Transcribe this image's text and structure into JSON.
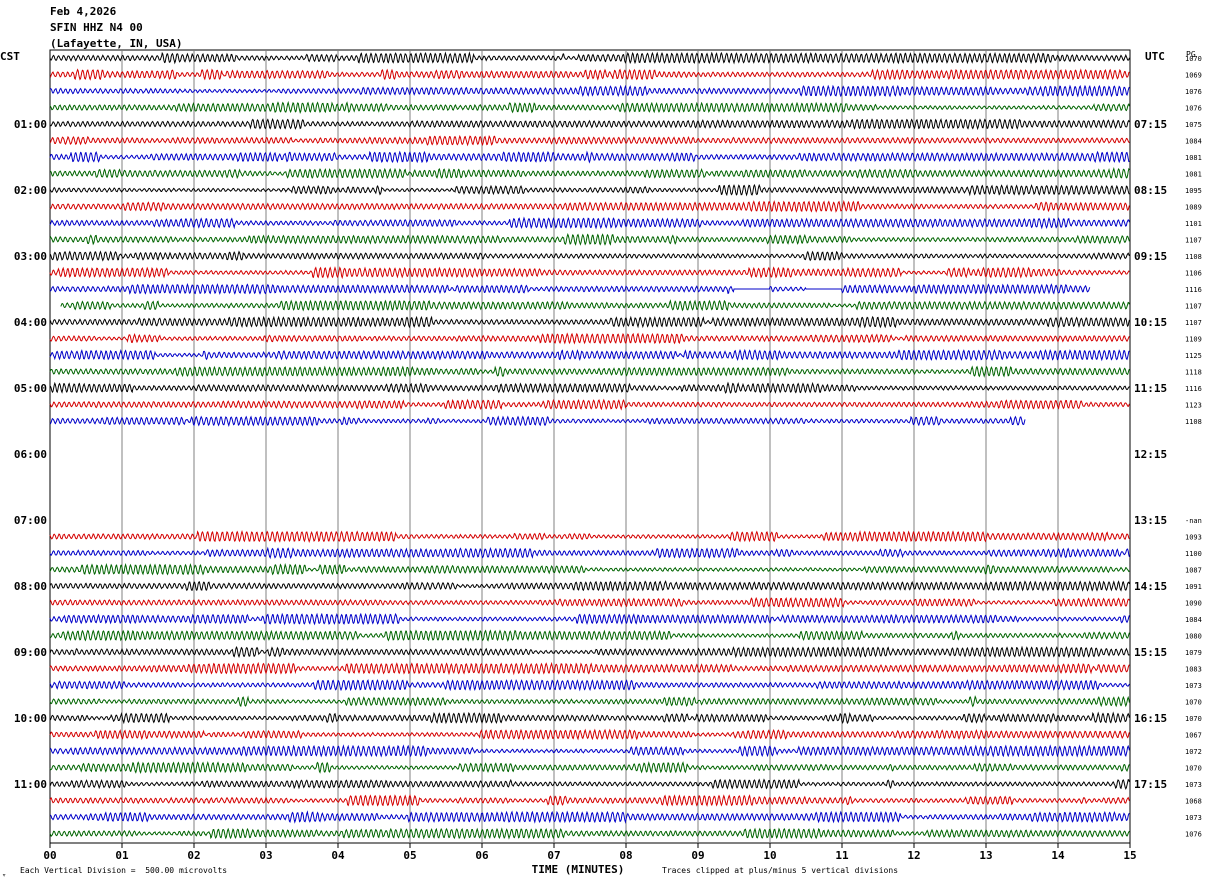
{
  "header": {
    "date": "Feb 4,2026",
    "station": "SFIN HHZ N4 00",
    "location": "(Lafayette, IN, USA)"
  },
  "left_tz": "CST",
  "right_tz": "UTC",
  "pg_label": "PG",
  "footer": {
    "scale": "Each Vertical Division =  500.00 microvolts",
    "clip": "Traces clipped at plus/minus 5 vertical divisions",
    "corner": "▿"
  },
  "colors": {
    "cycle": [
      "#000000",
      "#d40000",
      "#0000c8",
      "#006400"
    ],
    "grid": "#808080"
  },
  "chart_data": {
    "type": "line",
    "title": "Feb 4,2026 SFIN HHZ N4 00 (Lafayette, IN, USA)",
    "xlabel": "TIME (MINUTES)",
    "xlim": [
      0,
      15
    ],
    "x_ticks": [
      "00",
      "01",
      "02",
      "03",
      "04",
      "05",
      "06",
      "07",
      "08",
      "09",
      "10",
      "11",
      "12",
      "13",
      "14",
      "15"
    ],
    "grid": true,
    "lines_per_hour": 4,
    "minutes_per_line": 15,
    "y_left_hour_labels": [
      "01:00",
      "02:00",
      "03:00",
      "04:00",
      "05:00",
      "06:00",
      "07:00",
      "08:00",
      "09:00",
      "10:00",
      "11:00"
    ],
    "y_right_hour_labels": [
      "07:15",
      "08:15",
      "09:15",
      "10:15",
      "11:15",
      "12:15",
      "13:15",
      "14:15",
      "15:15",
      "16:15",
      "17:15"
    ],
    "traces": [
      {
        "line": 0,
        "color": "black",
        "amp": "1070",
        "start": 0,
        "end": 15
      },
      {
        "line": 1,
        "color": "red",
        "amp": "1069",
        "start": 0,
        "end": 15
      },
      {
        "line": 2,
        "color": "blue",
        "amp": "1076",
        "start": 0,
        "end": 15
      },
      {
        "line": 3,
        "color": "green",
        "amp": "1076",
        "start": 0,
        "end": 15
      },
      {
        "line": 4,
        "color": "black",
        "amp": "1075",
        "start": 0,
        "end": 15
      },
      {
        "line": 5,
        "color": "red",
        "amp": "1084",
        "start": 0,
        "end": 15
      },
      {
        "line": 6,
        "color": "blue",
        "amp": "1081",
        "start": 0,
        "end": 15
      },
      {
        "line": 7,
        "color": "green",
        "amp": "1081",
        "start": 0,
        "end": 15
      },
      {
        "line": 8,
        "color": "black",
        "amp": "1095",
        "start": 0,
        "end": 15
      },
      {
        "line": 9,
        "color": "red",
        "amp": "1089",
        "start": 0,
        "end": 15
      },
      {
        "line": 10,
        "color": "blue",
        "amp": "1101",
        "start": 0,
        "end": 15
      },
      {
        "line": 11,
        "color": "green",
        "amp": "1107",
        "start": 0,
        "end": 15
      },
      {
        "line": 12,
        "color": "black",
        "amp": "1108",
        "start": 0,
        "end": 15
      },
      {
        "line": 13,
        "color": "red",
        "amp": "1106",
        "start": 0,
        "end": 15
      },
      {
        "line": 14,
        "color": "blue",
        "amp": "1116",
        "start": 0,
        "end": 14.45,
        "gaps": [
          [
            9.5,
            10.0
          ],
          [
            10.5,
            11.0
          ]
        ]
      },
      {
        "line": 15,
        "color": "green",
        "amp": "1107",
        "start": 0.15,
        "end": 15
      },
      {
        "line": 16,
        "color": "black",
        "amp": "1107",
        "start": 0,
        "end": 15
      },
      {
        "line": 17,
        "color": "red",
        "amp": "1109",
        "start": 0,
        "end": 15
      },
      {
        "line": 18,
        "color": "blue",
        "amp": "1125",
        "start": 0,
        "end": 15
      },
      {
        "line": 19,
        "color": "green",
        "amp": "1118",
        "start": 0,
        "end": 15
      },
      {
        "line": 20,
        "color": "black",
        "amp": "1116",
        "start": 0,
        "end": 15
      },
      {
        "line": 21,
        "color": "red",
        "amp": "1123",
        "start": 0,
        "end": 15
      },
      {
        "line": 22,
        "color": "blue",
        "amp": "1108",
        "start": 0,
        "end": 13.55
      },
      {
        "line": 28,
        "color": "black",
        "amp": "-nan",
        "start": 0,
        "end": 0
      },
      {
        "line": 29,
        "color": "red",
        "amp": "1093",
        "start": 0,
        "end": 15
      },
      {
        "line": 30,
        "color": "blue",
        "amp": "1100",
        "start": 0,
        "end": 15
      },
      {
        "line": 31,
        "color": "green",
        "amp": "1087",
        "start": 0,
        "end": 15
      },
      {
        "line": 32,
        "color": "black",
        "amp": "1091",
        "start": 0,
        "end": 15
      },
      {
        "line": 33,
        "color": "red",
        "amp": "1090",
        "start": 0,
        "end": 15
      },
      {
        "line": 34,
        "color": "blue",
        "amp": "1084",
        "start": 0,
        "end": 15
      },
      {
        "line": 35,
        "color": "green",
        "amp": "1080",
        "start": 0,
        "end": 15
      },
      {
        "line": 36,
        "color": "black",
        "amp": "1079",
        "start": 0,
        "end": 15
      },
      {
        "line": 37,
        "color": "red",
        "amp": "1083",
        "start": 0,
        "end": 15
      },
      {
        "line": 38,
        "color": "blue",
        "amp": "1073",
        "start": 0,
        "end": 15
      },
      {
        "line": 39,
        "color": "green",
        "amp": "1070",
        "start": 0,
        "end": 15
      },
      {
        "line": 40,
        "color": "black",
        "amp": "1070",
        "start": 0,
        "end": 15
      },
      {
        "line": 41,
        "color": "red",
        "amp": "1067",
        "start": 0,
        "end": 15
      },
      {
        "line": 42,
        "color": "blue",
        "amp": "1072",
        "start": 0,
        "end": 15
      },
      {
        "line": 43,
        "color": "green",
        "amp": "1070",
        "start": 0,
        "end": 15
      },
      {
        "line": 44,
        "color": "black",
        "amp": "1073",
        "start": 0,
        "end": 15
      },
      {
        "line": 45,
        "color": "red",
        "amp": "1068",
        "start": 0,
        "end": 15
      },
      {
        "line": 46,
        "color": "blue",
        "amp": "1073",
        "start": 0,
        "end": 15
      },
      {
        "line": 47,
        "color": "green",
        "amp": "1076",
        "start": 0,
        "end": 15
      }
    ]
  }
}
